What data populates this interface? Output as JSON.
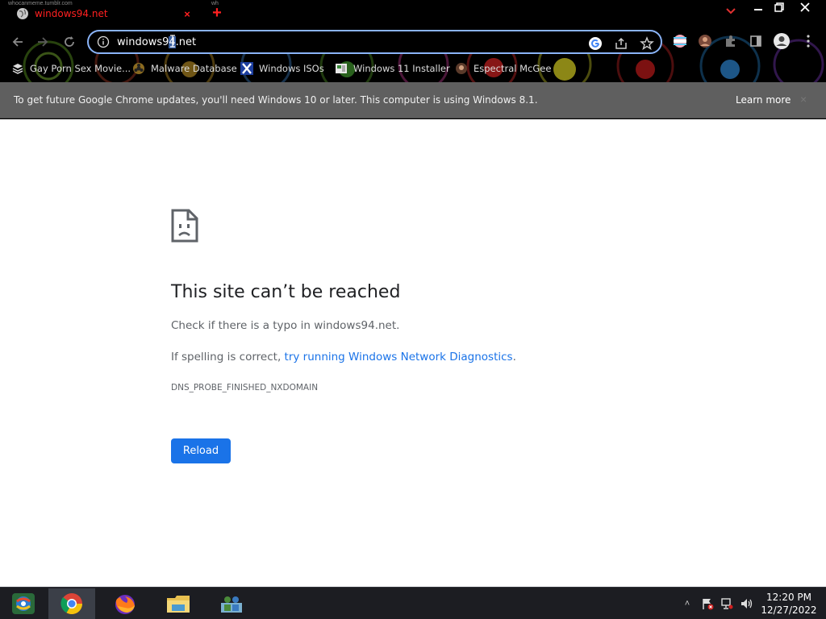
{
  "browser": {
    "tab": {
      "title": "windows94.net",
      "close_glyph": "×"
    },
    "new_tab_glyph": "+",
    "tab_watermark": "whocanmeme.tumblr.com",
    "tab_watermark_2": "wh",
    "address_bar": {
      "url_before": "windows9",
      "url_selected": "4",
      "url_after": ".net"
    },
    "bookmarks": [
      {
        "label": "Gay Porn Sex Movie...",
        "icon": "stack-icon"
      },
      {
        "label": "Malware Database",
        "icon": "biohazard-icon"
      },
      {
        "label": "Windows ISOs",
        "icon": "x-logo-icon"
      },
      {
        "label": "Windows 11 Installer",
        "icon": "installer-icon"
      },
      {
        "label": "Espectral McGee",
        "icon": "avatar-icon"
      }
    ],
    "infobar": {
      "message": "To get future Google Chrome updates, you'll need Windows 10 or later. This computer is using Windows 8.1.",
      "learn_more": "Learn more",
      "close_glyph": "×"
    },
    "accent_color": "#8ab4f8",
    "tab_text_color": "#ff2020"
  },
  "error_page": {
    "title": "This site can’t be reached",
    "line1": "Check if there is a typo in windows94.net.",
    "line2_prefix": "If spelling is correct, ",
    "line2_link": "try running Windows Network Diagnostics",
    "line2_suffix": ".",
    "error_code": "DNS_PROBE_FINISHED_NXDOMAIN",
    "reload_label": "Reload",
    "button_color": "#1a73e8"
  },
  "taskbar": {
    "items": [
      "start-button",
      "chrome",
      "firefox",
      "file-explorer",
      "network-app"
    ],
    "tray_chevron": "˄",
    "clock_time": "12:20 PM",
    "clock_date": "12/27/2022"
  }
}
